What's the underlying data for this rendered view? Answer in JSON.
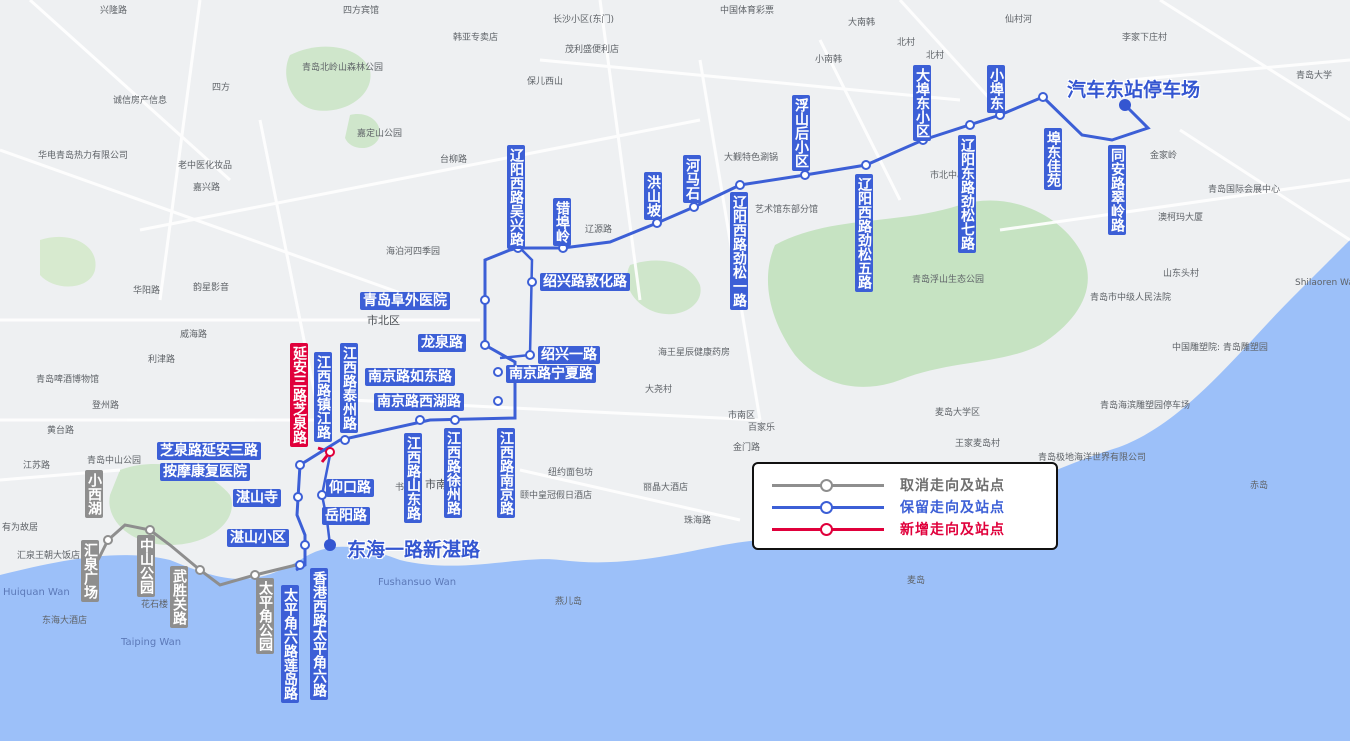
{
  "legend": {
    "cancelled": {
      "label": "取消走向及站点",
      "color": "#8e8e8e"
    },
    "retained": {
      "label": "保留走向及站点",
      "color": "#3c5fd6"
    },
    "added": {
      "label": "新增走向及站点",
      "color": "#e0003b"
    }
  },
  "terminals": {
    "north": "汽车东站停车场",
    "south": "东海一路新湛路"
  },
  "stops_blue_horizontal": [
    "青岛阜外医院",
    "龙泉路",
    "绍兴路敦化路",
    "绍兴一路",
    "南京路如东路",
    "南京路宁夏路",
    "南京路西湖路",
    "芝泉路延安三路",
    "按摩康复医院",
    "湛山寺",
    "仰口路",
    "岳阳路",
    "湛山小区"
  ],
  "stops_blue_vertical": [
    "同安路翠岭路",
    "埠东佳苑",
    "小埠东",
    "大埠东小区",
    "辽阳东路劲松七路",
    "辽阳西路劲松五路",
    "浮山后小区",
    "辽阳西路劲松一路",
    "河马石",
    "洪山坡",
    "错埠岭",
    "辽阳西路吴兴路",
    "江西路泰州路",
    "江西路镇江路",
    "江西路山东路",
    "江西路徐州路",
    "江西路南京路",
    "香港西路太平角六路",
    "太平角六路莲岛路"
  ],
  "stops_red": [
    "延安三路芝泉路"
  ],
  "stops_gray": [
    "小西湖",
    "汇泉广场",
    "中山公园",
    "武胜关路",
    "太平角公园"
  ],
  "basemap": {
    "districts": [
      "市北区",
      "市南区"
    ],
    "places": [
      "兴隆路",
      "四方宾馆",
      "长沙小区(东门)",
      "中国体育彩票",
      "大南韩",
      "仙村河",
      "李家下庄村",
      "青岛北岭山森林公园",
      "韩亚专卖店",
      "茂利盛便利店",
      "诚信房产信息",
      "保儿西山",
      "北村",
      "小南韩",
      "四方",
      "嘉定山公园",
      "华电青岛热力有限公司",
      "老中医化妆品",
      "嘉兴路",
      "台柳路",
      "海泊河四季园",
      "韵星影音",
      "金家岭",
      "青岛国际会展中心",
      "澳柯玛大厦",
      "市北中心",
      "艺术馆东部分馆",
      "大觐特色涮锅",
      "辽源路",
      "山东头村",
      "青岛浮山生态公园",
      "青岛市中级人民法院",
      "Shilaoren Wan",
      "青岛啤酒博物馆",
      "海王星辰健康药房",
      "大尧村",
      "中国雕塑院: 青岛雕塑园",
      "青岛海滨雕塑园停车场",
      "青岛大学",
      "市南区",
      "麦岛大学区",
      "王家麦岛村",
      "青岛极地海洋世界有限公司",
      "青岛中山公园",
      "纽约面包坊",
      "丽晶大酒店",
      "颐中皇冠假日酒店",
      "珠海路",
      "Fushansuo Wan",
      "燕儿岛",
      "麦岛",
      "赤岛",
      "Huiquan Wan",
      "花石楼",
      "东海大酒店",
      "Taiping Wan",
      "汇泉王朝大饭店",
      "有为故居",
      "黄台路",
      "江苏路",
      "登州路",
      "百家乐",
      "金门路",
      "利津路",
      "威海路",
      "华阳路",
      "北村",
      "书馆"
    ]
  }
}
